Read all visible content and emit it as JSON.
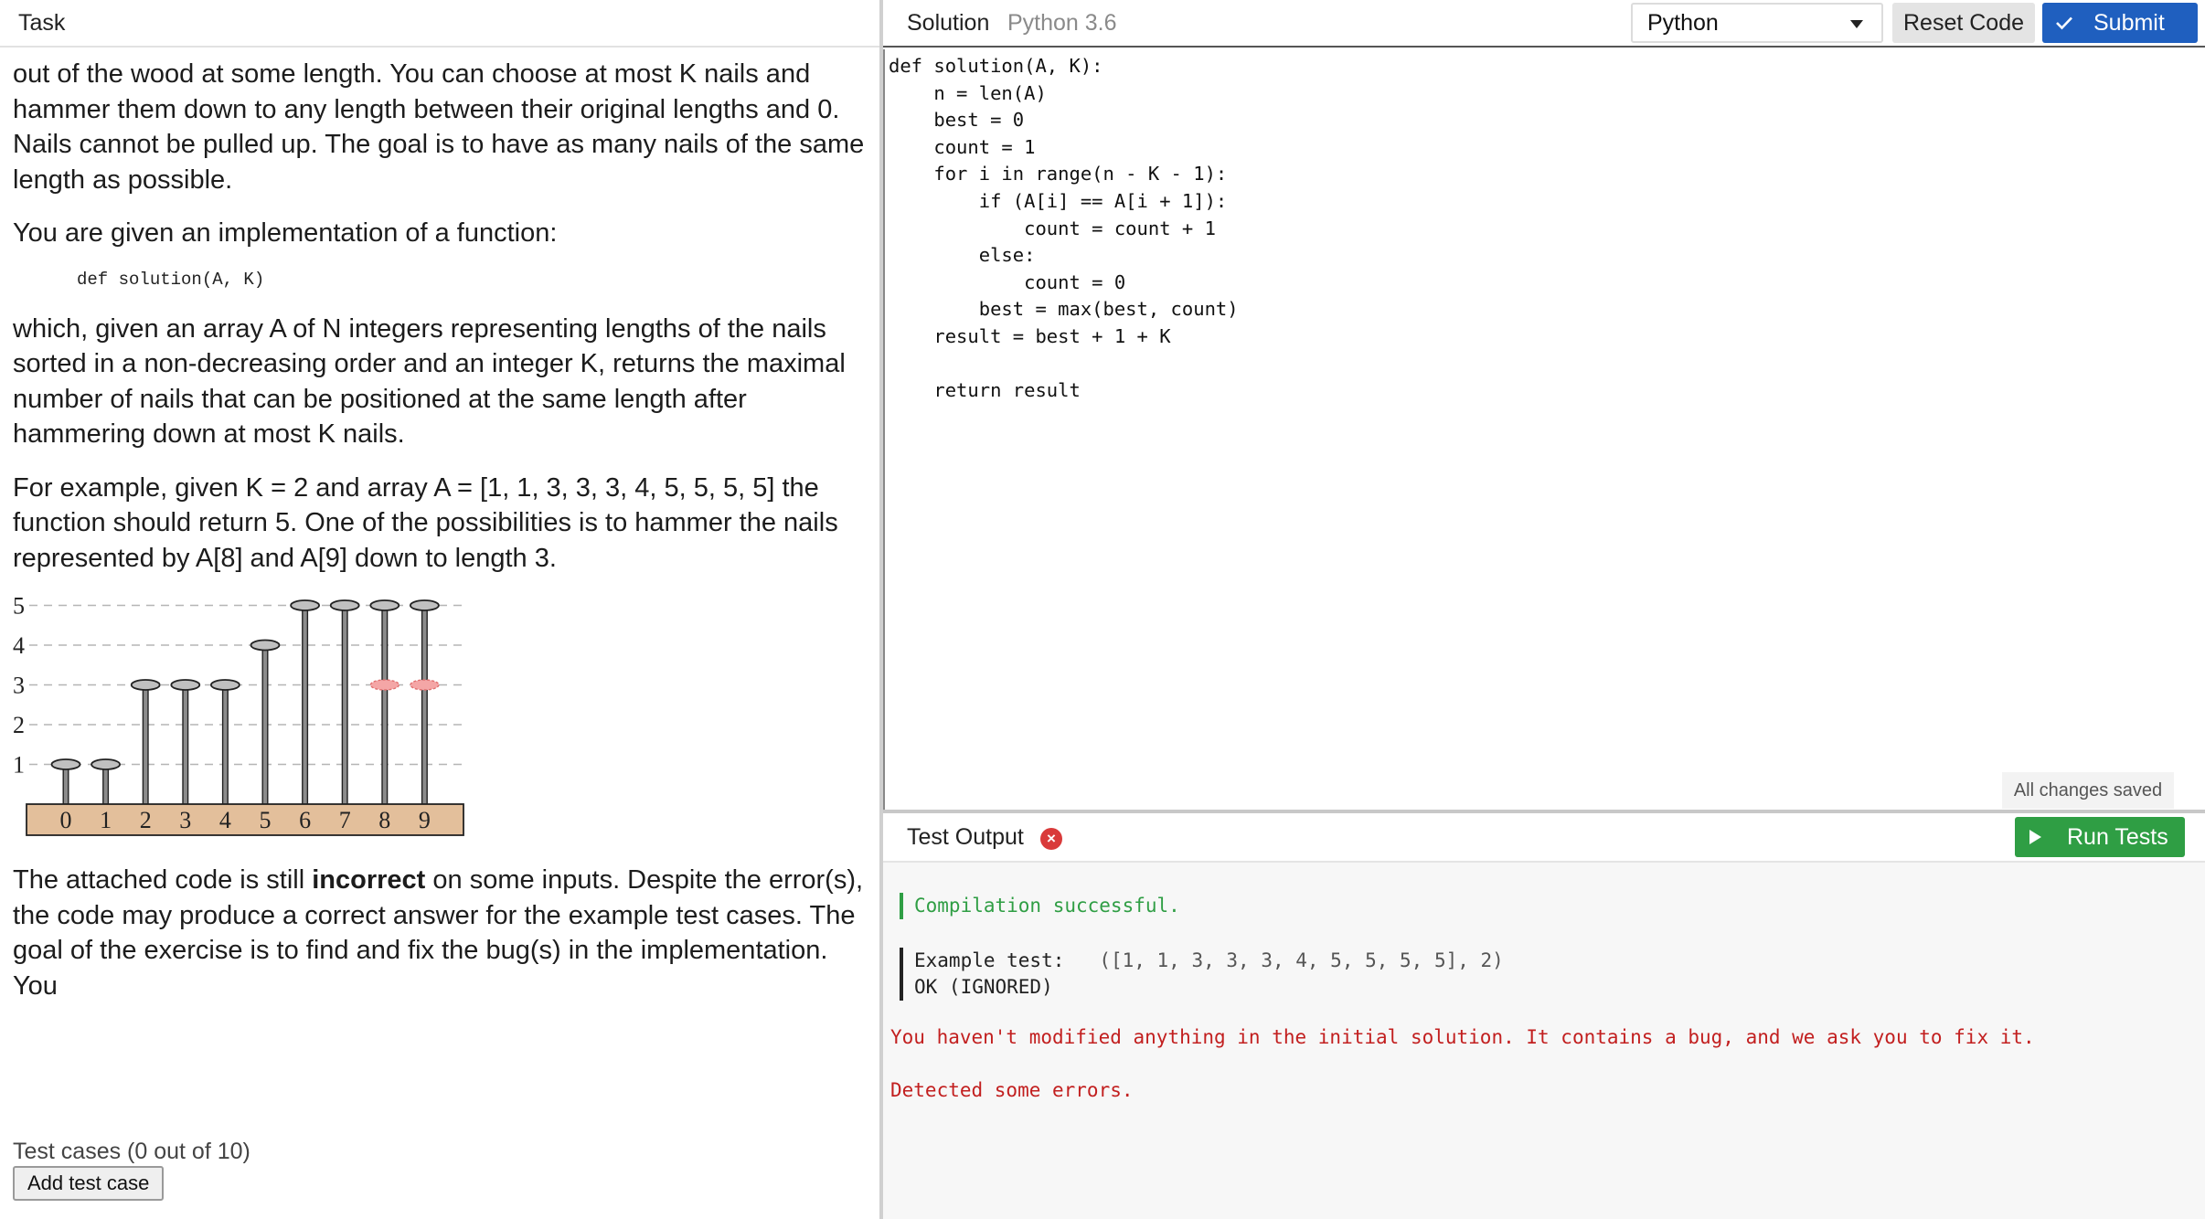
{
  "task": {
    "header": "Task",
    "para1": "out of the wood at some length. You can choose at most K nails and hammer them down to any length between their original lengths and 0. Nails cannot be pulled up. The goal is to have as many nails of the same length as possible.",
    "para2": "You are given an implementation of a function:",
    "signature": "def solution(A, K)",
    "para3": "which, given an array A of N integers representing lengths of the nails sorted in a non-decreasing order and an integer K, returns the maximal number of nails that can be positioned at the same length after hammering down at most K nails.",
    "para4": "For example, given K = 2 and array A = [1, 1, 3, 3, 3, 4, 5, 5, 5, 5] the function should return 5. One of the possibilities is to hammer the nails represented by A[8] and A[9] down to length 3.",
    "para5_a": "The attached code is still ",
    "para5_b": "incorrect",
    "para5_c": " on some inputs. Despite the error(s), the code may produce a correct answer for the example test cases. The goal of the exercise is to find and fix the bug(s) in the implementation. You",
    "test_cases_label": "Test cases (0 out of 10)",
    "add_test_case": "Add test case"
  },
  "figure": {
    "y_labels": [
      "5",
      "4",
      "3",
      "2",
      "1"
    ],
    "nail_heights": [
      1,
      1,
      3,
      3,
      3,
      4,
      5,
      5,
      5,
      5
    ],
    "nail_labels": [
      "0",
      "1",
      "2",
      "3",
      "4",
      "5",
      "6",
      "7",
      "8",
      "9"
    ],
    "hammered_nails": [
      8,
      9
    ],
    "hammered_to": 3,
    "hammer_color": "#f4a6a6",
    "wood_color": "#e3bf9b"
  },
  "solution": {
    "title": "Solution",
    "lang_version": "Python 3.6",
    "language": "Python",
    "reset_label": "Reset Code",
    "submit_label": "Submit",
    "code": "def solution(A, K):\n    n = len(A)\n    best = 0\n    count = 1\n    for i in range(n - K - 1):\n        if (A[i] == A[i + 1]):\n            count = count + 1\n        else:\n            count = 0\n        best = max(best, count)\n    result = best + 1 + K\n\n    return result",
    "saved_label": "All changes saved"
  },
  "output": {
    "title": "Test Output",
    "run_label": "Run Tests",
    "compile_msg": "Compilation successful.",
    "example_label": "Example test:",
    "example_args": "([1, 1, 3, 3, 3, 4, 5, 5, 5, 5], 2)",
    "example_result": "OK (IGNORED)",
    "warning": "You haven't modified anything in the initial solution. It contains a bug, and we ask you to fix it.",
    "errors": "Detected some errors."
  },
  "colors": {
    "submit": "#1f5fbf",
    "run": "#2f9e44",
    "success": "#2f9e44",
    "error": "#c21f1f"
  }
}
